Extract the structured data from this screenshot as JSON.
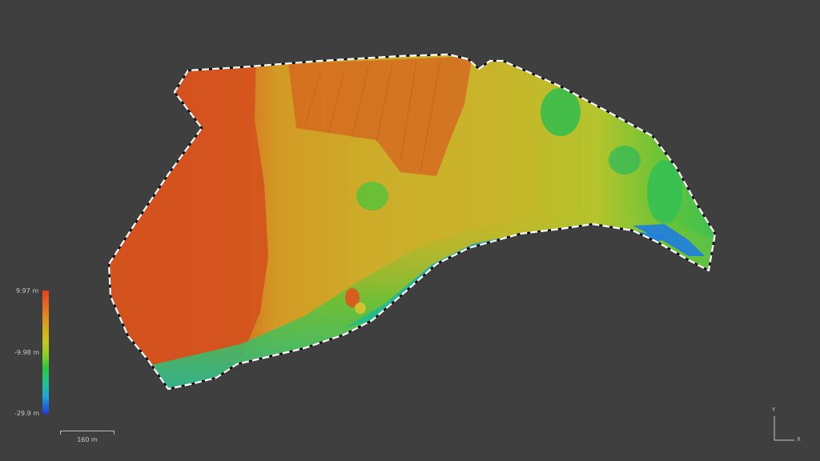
{
  "legend": {
    "max_label": "9.97 m",
    "mid_label": "-9.98 m",
    "min_label": "-29.9 m",
    "colors": [
      "#e8401c",
      "#d9a11c",
      "#2fc63a",
      "#1aa6d8",
      "#1f3ed8"
    ]
  },
  "scale": {
    "label": "160 m"
  },
  "axes": {
    "y_label": "Y",
    "x_label": "X"
  },
  "map": {
    "background": "#3f3f3f",
    "boundary_style": "dashed-white-black"
  }
}
